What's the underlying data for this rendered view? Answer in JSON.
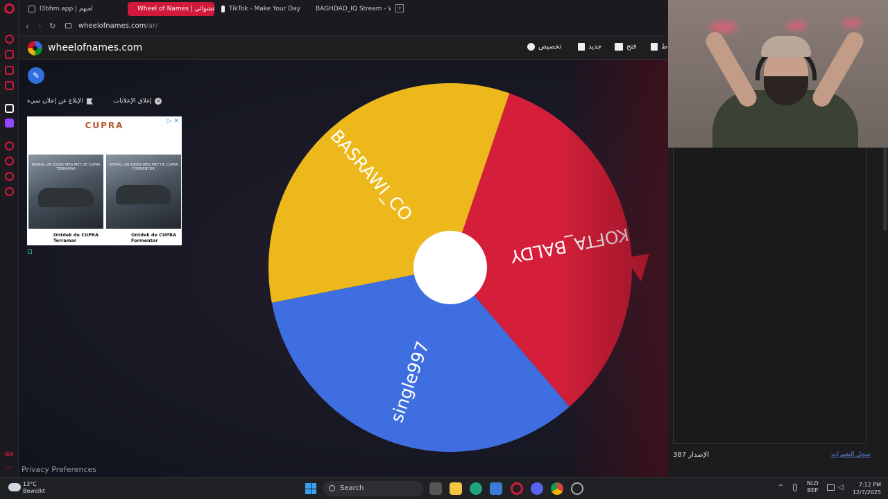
{
  "browser": {
    "tabs": [
      {
        "label": "l3bhm.app | لعبهم"
      },
      {
        "label": "Wheel of Names | عشوائي"
      },
      {
        "label": "TikTok - Make Your Day"
      },
      {
        "label": "BAGHDAD_IQ Stream - W"
      }
    ],
    "new_tab": "+",
    "url_host": "wheelofnames.com",
    "url_path": "/ar/"
  },
  "header": {
    "site_name": "wheelofnames.com",
    "customize": "تخصيص",
    "new": "جديد",
    "open": "فتح",
    "save": "ط"
  },
  "ads": {
    "close_ads": "إغلاق الإعلانات",
    "report_ad": "الإبلاغ عن إعلان سيء",
    "brand": "CUPRA",
    "img1_tag": "BEPAAL UW EIGEN WEG MET DE CUPRA TERRAMAR",
    "img2_tag": "BEPAAL UW EIGEN WEG MET DE CUPRA FORMENTOR",
    "caption1": "Ontdek de CUPRA Terramar",
    "caption2": "Ontdek de CUPRA Formentor"
  },
  "wheel": {
    "segments": [
      {
        "label": "KOFTA_BALDY",
        "color": "#d51f3a"
      },
      {
        "label": "single997",
        "color": "#3e6ee0"
      },
      {
        "label": "BASRAWI_CO",
        "color": "#ecb81b"
      }
    ]
  },
  "privacy": "Privacy Preferences",
  "panel": {
    "version_label": "الإصدار",
    "version_number": "387",
    "changelog": "سجل التغييرات"
  },
  "taskbar": {
    "temp": "13°C",
    "weather": "Bewolkt",
    "search": "Search",
    "lang1": "NLD",
    "lang2": "BEP",
    "time": "7:12 PM",
    "date": "12/7/2025"
  }
}
